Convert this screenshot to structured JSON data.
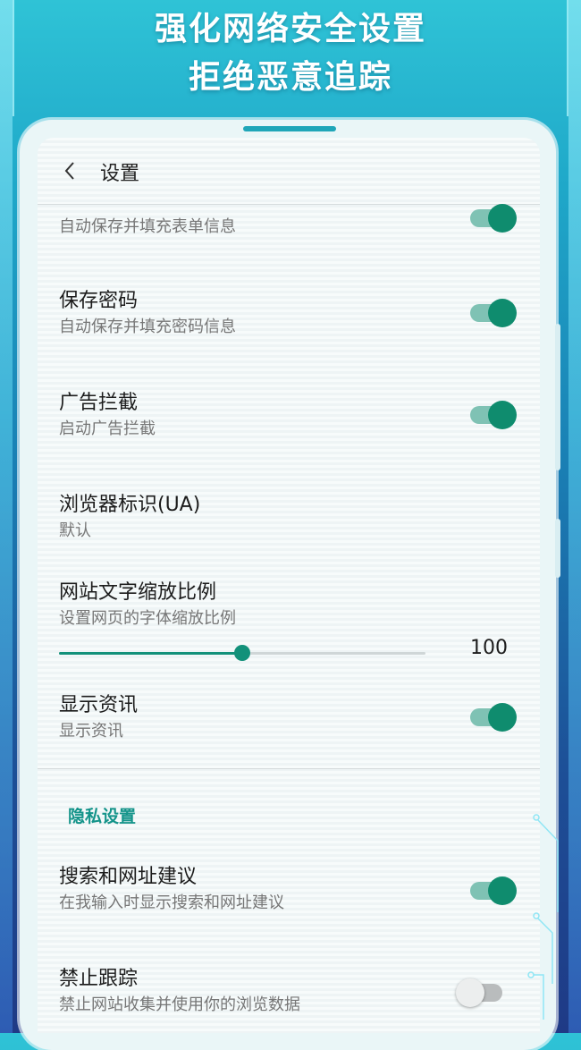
{
  "banner": {
    "line1": "强化网络安全设置",
    "line2": "拒绝恶意追踪"
  },
  "header": {
    "back_icon": "chevron-left-icon",
    "title": "设置"
  },
  "settings": [
    {
      "title": "",
      "subtitle": "自动保存并填充表单信息",
      "toggle": true
    },
    {
      "title": "保存密码",
      "subtitle": "自动保存并填充密码信息",
      "toggle": true
    },
    {
      "title": "广告拦截",
      "subtitle": "启动广告拦截",
      "toggle": true
    },
    {
      "title": "浏览器标识(UA)",
      "subtitle": "默认"
    },
    {
      "title": "网站文字缩放比例",
      "subtitle": "设置网页的字体缩放比例",
      "slider_value": "100",
      "slider_fraction": 0.5
    },
    {
      "title": "显示资讯",
      "subtitle": "显示资讯",
      "toggle": true
    }
  ],
  "privacy_section": {
    "label": "隐私设置",
    "items": [
      {
        "title": "搜索和网址建议",
        "subtitle": "在我输入时显示搜索和网址建议",
        "toggle": true
      },
      {
        "title": "禁止跟踪",
        "subtitle": "禁止网站收集并使用你的浏览数据",
        "toggle": false
      }
    ]
  },
  "colors": {
    "accent": "#0f8c6e",
    "section_label": "#14948a",
    "background_top": "#2fc3d6",
    "background_bottom": "#1f3a86"
  }
}
